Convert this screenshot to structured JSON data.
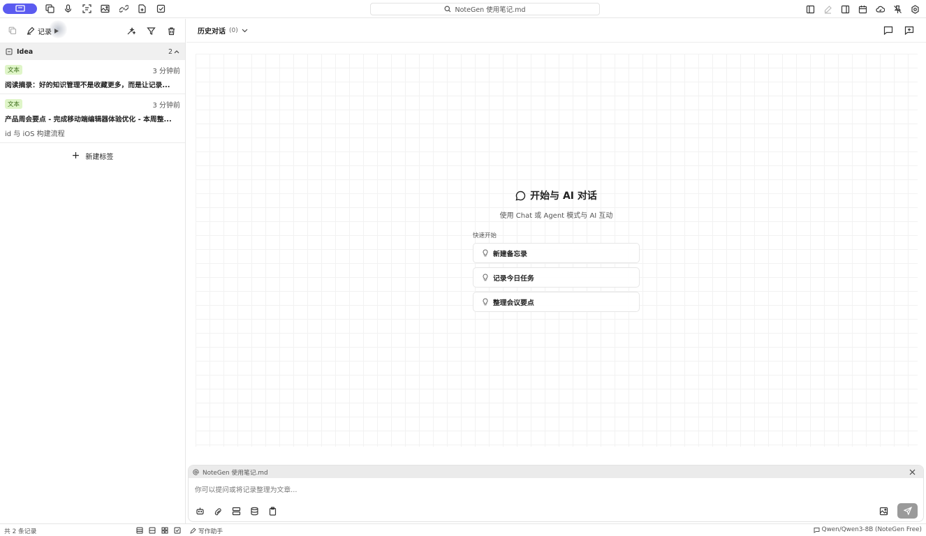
{
  "window": {
    "search_title": "NoteGen 使用笔记.md"
  },
  "sidebar": {
    "active_tab_label": "记录",
    "group": {
      "name": "Idea",
      "count": "2"
    },
    "notes": [
      {
        "badge": "文本",
        "time": "3 分钟前",
        "title": "阅读摘录：好的知识管理不是收藏更多，而是让记录...",
        "sub": ""
      },
      {
        "badge": "文本",
        "time": "3 分钟前",
        "title": "产品周会要点 - 完成移动端编辑器体验优化 - 本周整...",
        "sub": "id 与 iOS 构建流程"
      }
    ],
    "new_tag_label": "新建标签"
  },
  "main": {
    "history_label": "历史对话",
    "history_count": "(0)",
    "welcome_title": "开始与 AI 对话",
    "welcome_sub": "使用 Chat 或 Agent 模式与 AI 互动",
    "quick_label": "快速开始",
    "quick_items": [
      "新建备忘录",
      "记录今日任务",
      "整理会议要点"
    ]
  },
  "composer": {
    "context_file": "NoteGen 使用笔记.md",
    "placeholder": "你可以提问或将记录整理为文章..."
  },
  "statusbar": {
    "record_count": "共 2 条记录",
    "assistant_label": "写作助手",
    "model_label": "Qwen/Qwen3-8B (NoteGen Free)"
  },
  "colors": {
    "accent": "#5b5bf0",
    "badge_bg": "#dff5c8",
    "badge_text": "#3a6b17"
  }
}
